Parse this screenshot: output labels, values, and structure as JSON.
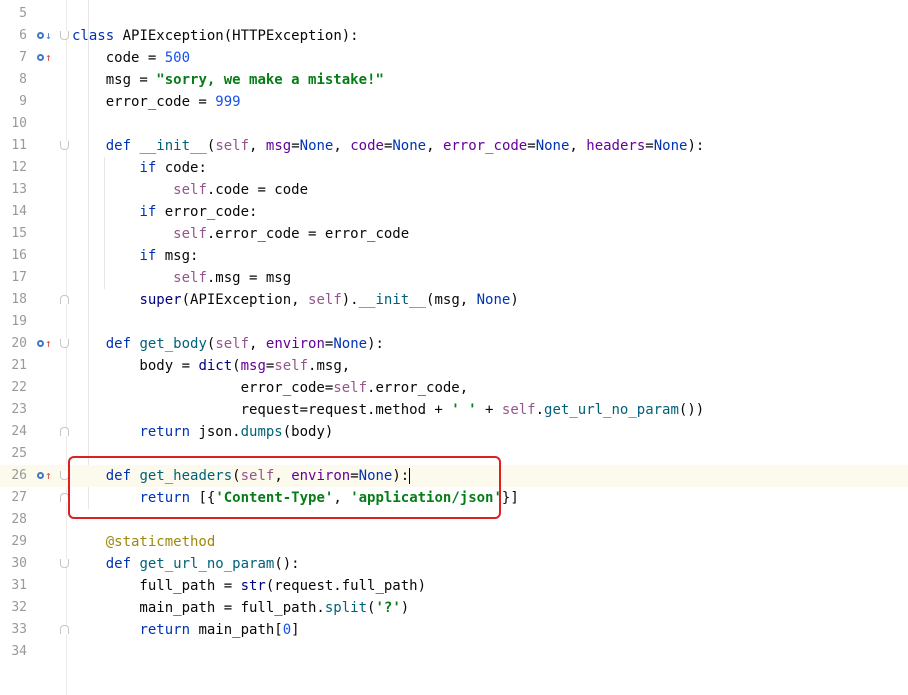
{
  "editor": {
    "language": "python",
    "current_line": 26,
    "lines": [
      {
        "n": "5",
        "text": ""
      },
      {
        "n": "6",
        "text": "class APIException(HTTPException):"
      },
      {
        "n": "7",
        "text": "    code = 500"
      },
      {
        "n": "8",
        "text": "    msg = \"sorry, we make a mistake!\""
      },
      {
        "n": "9",
        "text": "    error_code = 999"
      },
      {
        "n": "10",
        "text": ""
      },
      {
        "n": "11",
        "text": "    def __init__(self, msg=None, code=None, error_code=None, headers=None):"
      },
      {
        "n": "12",
        "text": "        if code:"
      },
      {
        "n": "13",
        "text": "            self.code = code"
      },
      {
        "n": "14",
        "text": "        if error_code:"
      },
      {
        "n": "15",
        "text": "            self.error_code = error_code"
      },
      {
        "n": "16",
        "text": "        if msg:"
      },
      {
        "n": "17",
        "text": "            self.msg = msg"
      },
      {
        "n": "18",
        "text": "        super(APIException, self).__init__(msg, None)"
      },
      {
        "n": "19",
        "text": ""
      },
      {
        "n": "20",
        "text": "    def get_body(self, environ=None):"
      },
      {
        "n": "21",
        "text": "        body = dict(msg=self.msg,"
      },
      {
        "n": "22",
        "text": "                    error_code=self.error_code,"
      },
      {
        "n": "23",
        "text": "                    request=request.method + ' ' + self.get_url_no_param())"
      },
      {
        "n": "24",
        "text": "        return json.dumps(body)"
      },
      {
        "n": "25",
        "text": ""
      },
      {
        "n": "26",
        "text": "    def get_headers(self, environ=None):"
      },
      {
        "n": "27",
        "text": "        return [{'Content-Type', 'application/json'}]"
      },
      {
        "n": "28",
        "text": ""
      },
      {
        "n": "29",
        "text": "    @staticmethod"
      },
      {
        "n": "30",
        "text": "    def get_url_no_param():"
      },
      {
        "n": "31",
        "text": "        full_path = str(request.full_path)"
      },
      {
        "n": "32",
        "text": "        main_path = full_path.split('?')"
      },
      {
        "n": "33",
        "text": "        return main_path[0]"
      },
      {
        "n": "34",
        "text": ""
      }
    ]
  },
  "gutter_icons": {
    "6": "override-down-icon",
    "7": "override-up-icon",
    "20": "override-up-icon",
    "26": "override-up-icon"
  },
  "colors": {
    "keyword": "#0033b3",
    "number": "#1750eb",
    "string": "#067d17",
    "self": "#94558d",
    "decorator": "#9e880d",
    "highlight_box": "#e02020",
    "current_line": "#fcfaed"
  }
}
